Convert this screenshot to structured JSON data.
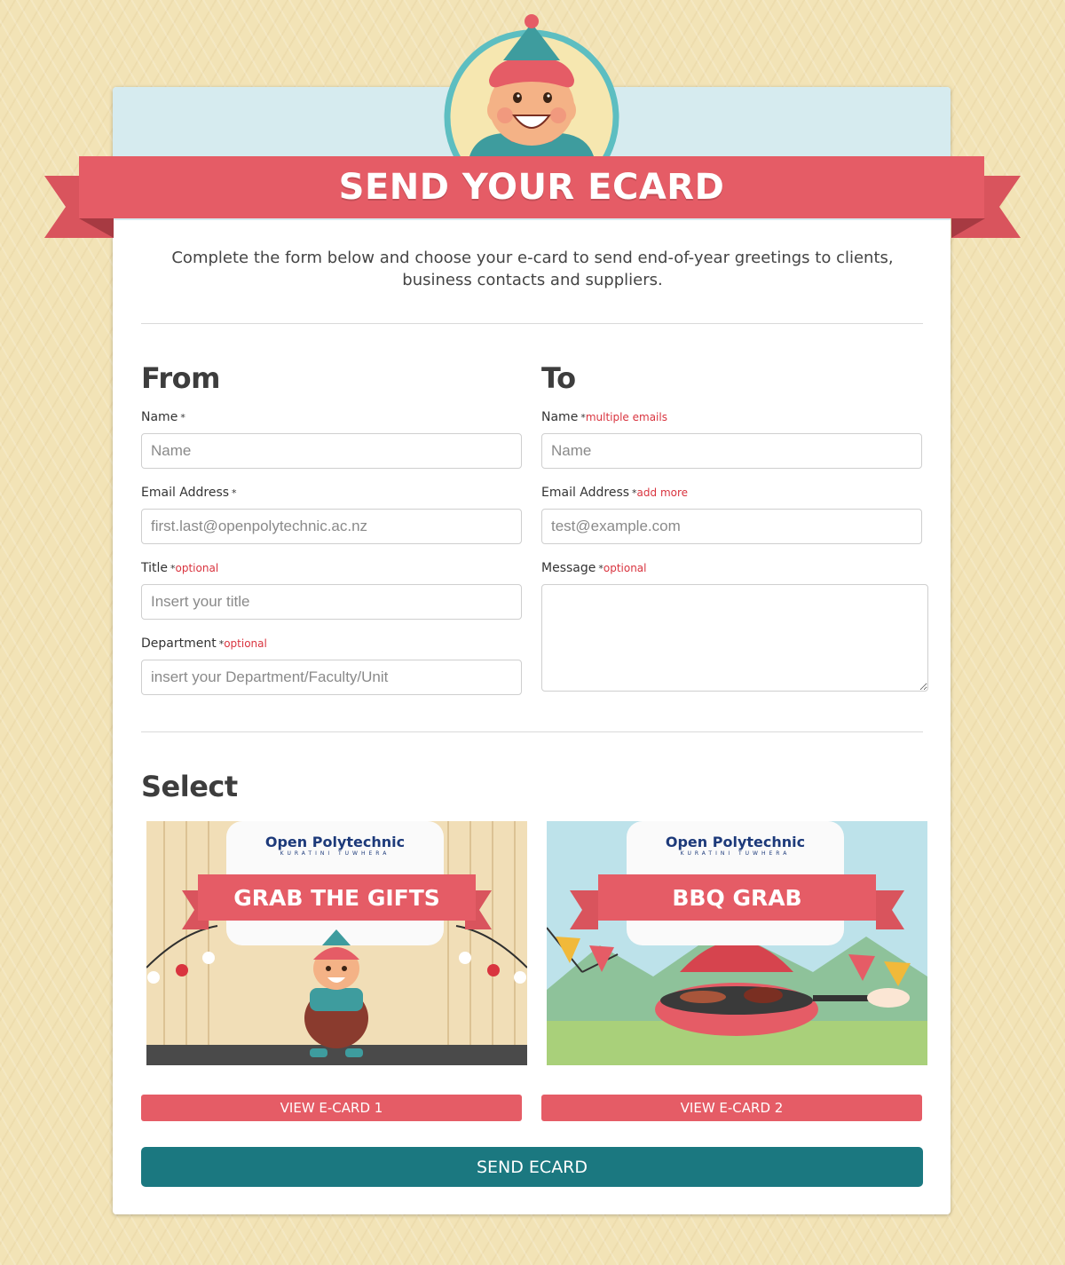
{
  "header": {
    "title": "SEND YOUR ECARD",
    "intro": "Complete the form below and choose your e-card to send end-of-year greetings to clients, business contacts and suppliers."
  },
  "from": {
    "heading": "From",
    "name": {
      "label": "Name",
      "required": "*",
      "placeholder": "Name"
    },
    "email": {
      "label": "Email Address",
      "required": "*",
      "placeholder": "first.last@openpolytechnic.ac.nz"
    },
    "title": {
      "label": "Title",
      "required": "*",
      "note": "optional",
      "placeholder": "Insert your title"
    },
    "department": {
      "label": "Department",
      "required": "*",
      "note": "optional",
      "placeholder": "insert your Department/Faculty/Unit"
    }
  },
  "to": {
    "heading": "To",
    "name": {
      "label": "Name",
      "required": "*",
      "note": "multiple emails",
      "placeholder": "Name"
    },
    "email": {
      "label": "Email Address",
      "required": "*",
      "note": "add more",
      "placeholder": "test@example.com"
    },
    "message": {
      "label": "Message",
      "required": "*",
      "note": "optional",
      "placeholder": ""
    }
  },
  "select": {
    "heading": "Select",
    "cards": [
      {
        "brand": "Open Polytechnic",
        "brand_sub": "KURATINI TUWHERA",
        "title": "GRAB THE GIFTS",
        "button": "VIEW E-CARD 1"
      },
      {
        "brand": "Open Polytechnic",
        "brand_sub": "KURATINI TUWHERA",
        "title": "BBQ GRAB",
        "button": "VIEW E-CARD 2"
      }
    ]
  },
  "send_button": "SEND ECARD",
  "colors": {
    "background": "#f2e3b6",
    "ribbon": "#e55c66",
    "header_band": "#d6ebef",
    "send_button": "#1b7880",
    "note_red": "#d9343f",
    "brand_blue": "#1d3a7a"
  }
}
